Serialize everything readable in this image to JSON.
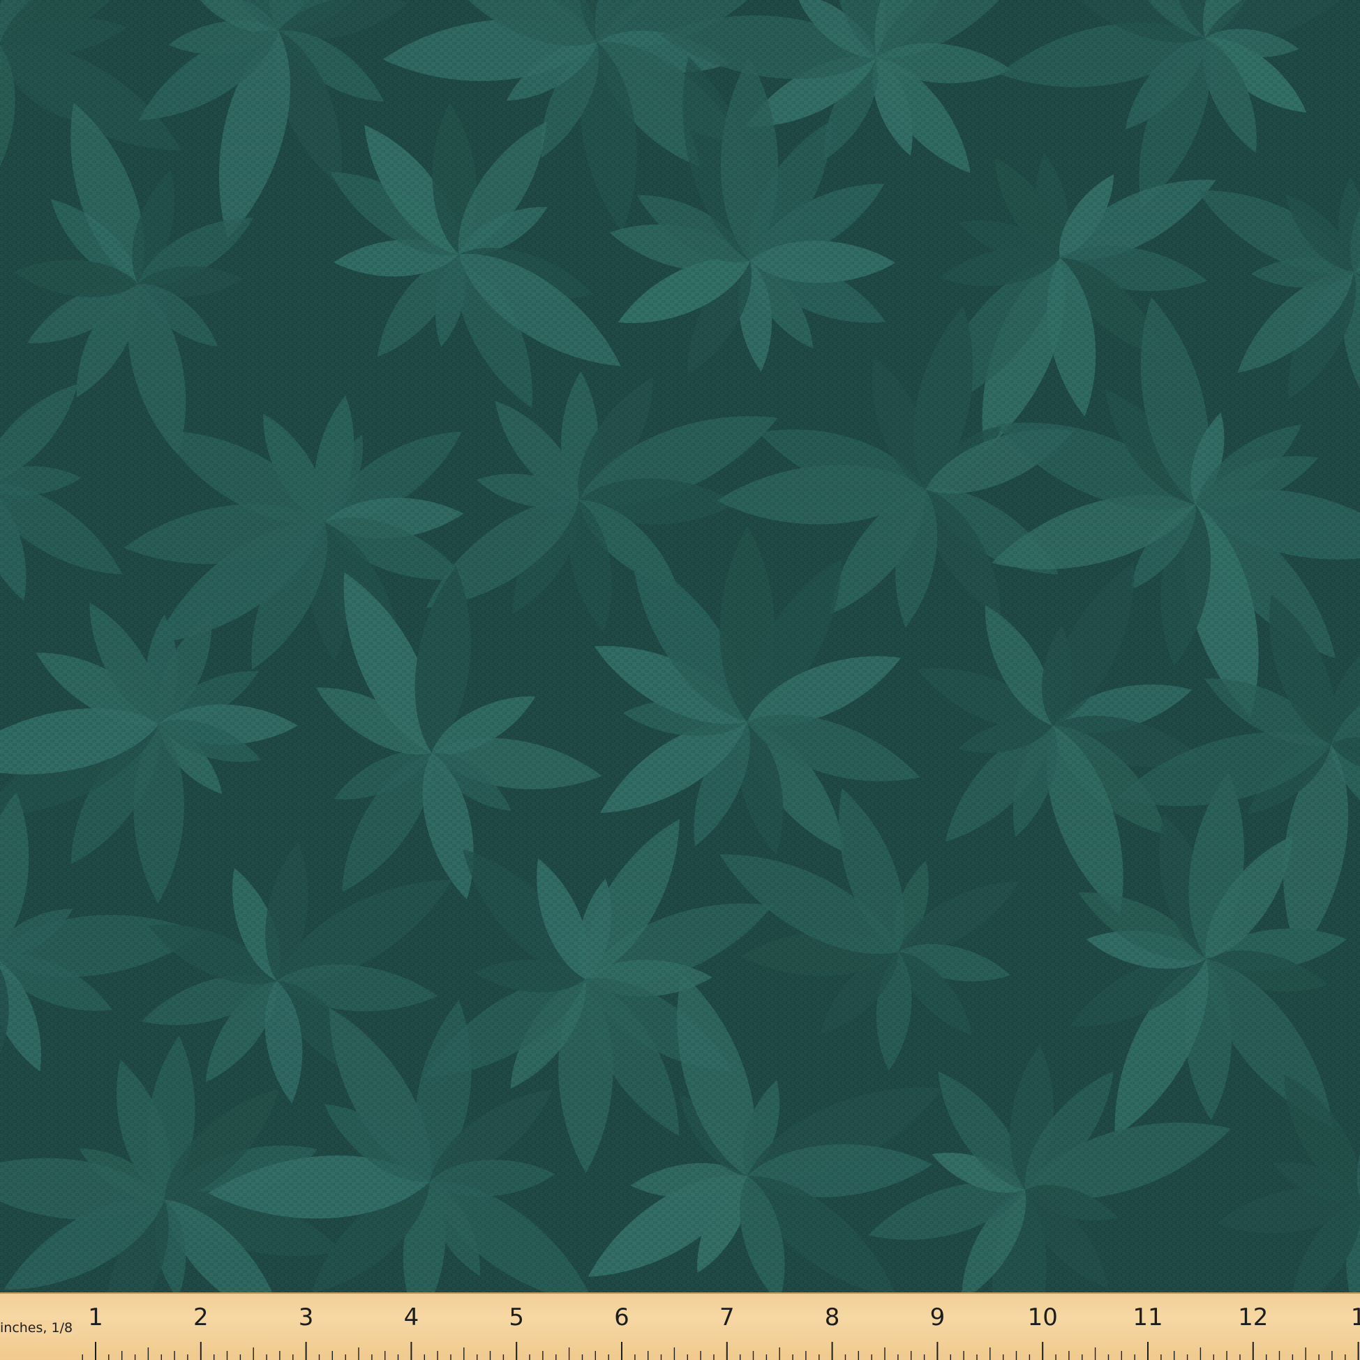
{
  "fabric": {
    "pattern": "teal-leaf-clusters",
    "colors": {
      "background": "#1f4a46",
      "leaf_dark": "#24524d",
      "leaf_mid": "#2b625b",
      "leaf_light": "#336f67",
      "weave": "#163c38"
    }
  },
  "ruler": {
    "unit_label": "inches, 1/8",
    "numbers": [
      "1",
      "2",
      "3",
      "4",
      "5",
      "6",
      "7",
      "8",
      "9",
      "10",
      "11",
      "12",
      "1"
    ],
    "colors": {
      "wood": "#f4d49c",
      "ink": "#1d1d1d"
    }
  }
}
